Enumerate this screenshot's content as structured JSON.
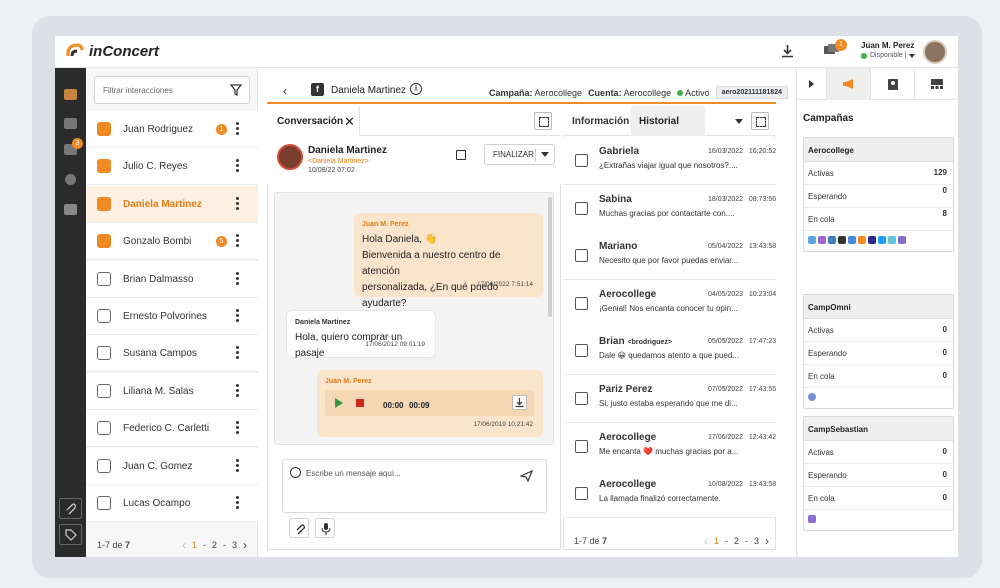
{
  "topbar": {
    "logo_text": "inConcert",
    "chat_badge": "1",
    "user_name": "Juan M. Perez",
    "user_status": "Disponible |"
  },
  "rail": {
    "badge": "3"
  },
  "list": {
    "filter_placeholder": "Filtrar interacciones",
    "items": [
      {
        "name": "Juan Rodriguez",
        "icon": "webchat-icon",
        "badge": "1",
        "color": "#f08a24"
      },
      {
        "name": "Julio C. Reyes",
        "icon": "twitter-icon",
        "badge": "",
        "color": "#f08a24"
      },
      {
        "name": "Daniela Martinez",
        "icon": "facebook-icon",
        "badge": "",
        "color": "#f08a24"
      },
      {
        "name": "Gonzalo Bombi",
        "icon": "video-icon",
        "badge": "5",
        "color": "#f08a24"
      },
      {
        "name": "Brian Dalmasso",
        "icon": "email-at-icon",
        "badge": "",
        "color": "#666"
      },
      {
        "name": "Ernesto Polvorines",
        "icon": "chat-bubbles-icon",
        "badge": "",
        "color": "#666"
      },
      {
        "name": "Susana Campos",
        "icon": "mail-icon",
        "badge": "",
        "color": "#666"
      },
      {
        "name": "Liliana M. Salas",
        "icon": "id-card-icon",
        "badge": "",
        "color": "#666"
      },
      {
        "name": "Federico C. Carletti",
        "icon": "cursor-icon",
        "badge": "",
        "color": "#666"
      },
      {
        "name": "Juan C. Gomez",
        "icon": "form-icon",
        "badge": "",
        "color": "#666"
      },
      {
        "name": "Lucas Ocampo",
        "icon": "survey-icon",
        "badge": "",
        "color": "#666"
      }
    ],
    "pager_label": "1-7 de",
    "pager_total": "7",
    "pages": [
      "1",
      "-",
      "2",
      "-",
      "3"
    ]
  },
  "conversation": {
    "header_name": "Daniela Martinez",
    "campaign_label": "Campaña:",
    "campaign_value": "Aerocollege",
    "account_label": "Cuenta:",
    "account_value": "Aerocollege",
    "status": "Activo",
    "id": "aero202111181824",
    "tab_label": "Conversación",
    "contact_name": "Daniela Martinez",
    "contact_sub": "<Daniela Martinez>",
    "contact_date": "10/08/22 07:02",
    "finalize_label": "FINALIZAR",
    "messages": [
      {
        "author": "Juan M. Perez",
        "text1": "Hola Daniela, 👋",
        "text2": "Bienvenida a nuestro centro de atención",
        "text3": "personalizada, ¿En qué puedo ayudarte?",
        "time": "17/06/2022 7:51:14"
      },
      {
        "author": "Daniela Martinez",
        "text1": "Hola, quiero comprar un pasaje",
        "time": "17/06/2012 09:01:19"
      },
      {
        "author": "Juan M. Perez",
        "audio_start": "00:00",
        "audio_end": "00:09",
        "time": "17/06/2019 10:21:42"
      }
    ],
    "composer_placeholder": "Escribe un mensaje aquí..."
  },
  "history": {
    "tab_info": "Información",
    "tab_history": "Historial",
    "items": [
      {
        "name": "Gabriela",
        "handle": "",
        "date": "16/03/2022",
        "time": "16:20:52",
        "text": "¿Extrañas viajar igual que nosotros?....",
        "icon": "facebook-icon"
      },
      {
        "name": "Sabina",
        "handle": "",
        "date": "18/03/2022",
        "time": "08:73:56",
        "text": "Muchas gracias por contactarte con....",
        "icon": "mail-icon"
      },
      {
        "name": "Mariano",
        "handle": "",
        "date": "05/04/2022",
        "time": "13:43:58",
        "text": "Necesito que por favor puedas enviar...",
        "icon": "video-icon"
      },
      {
        "name": "Aerocollege",
        "handle": "",
        "date": "04/05/2023",
        "time": "10:23:04",
        "text": "¡Genial! Nos encanta conocer tu opin...",
        "icon": "twitter-icon"
      },
      {
        "name": "Brian",
        "handle": "<brodriguez>",
        "date": "05/05/2022",
        "time": "17:47:23",
        "text": "Dale 😀 quedamos atento a que pued...",
        "icon": "chat-bubbles-icon"
      },
      {
        "name": "Pariz Perez",
        "handle": "",
        "date": "07/05/2022",
        "time": "17:43:55",
        "text": "Si, justo estaba esperando que me di...",
        "icon": "twitter-icon"
      },
      {
        "name": "Aerocollege",
        "handle": "",
        "date": "17/06/2022",
        "time": "12:43:42",
        "text": "Me encanta ❤️ muchas gracias por a...",
        "icon": "chat-bubbles-icon"
      },
      {
        "name": "Aerocollege",
        "handle": "",
        "date": "10/08/2022",
        "time": "13:43:58",
        "text": "La llamada finalizó correctamente.",
        "icon": "phone-icon"
      }
    ],
    "pager_label": "1-7 de",
    "pager_total": "7"
  },
  "campaigns": {
    "title": "Campañas",
    "cards": [
      {
        "name": "Aerocollege",
        "rows": [
          {
            "label": "Activas",
            "value": "129"
          },
          {
            "label": "Esperando",
            "value": "0"
          },
          {
            "label": "En cola",
            "value": "8"
          }
        ]
      },
      {
        "name": "CampOmni",
        "rows": [
          {
            "label": "Activas",
            "value": "0"
          },
          {
            "label": "Esperando",
            "value": "0"
          },
          {
            "label": "En cola",
            "value": "0"
          }
        ]
      },
      {
        "name": "CampSebastian",
        "rows": [
          {
            "label": "Activas",
            "value": "0"
          },
          {
            "label": "Esperando",
            "value": "0"
          },
          {
            "label": "En cola",
            "value": "0"
          }
        ]
      }
    ]
  },
  "colors": {
    "accent": "#f08a24",
    "active_row": "#fdefe1",
    "rail": "#2b2b2b",
    "online": "#3bb54a"
  }
}
